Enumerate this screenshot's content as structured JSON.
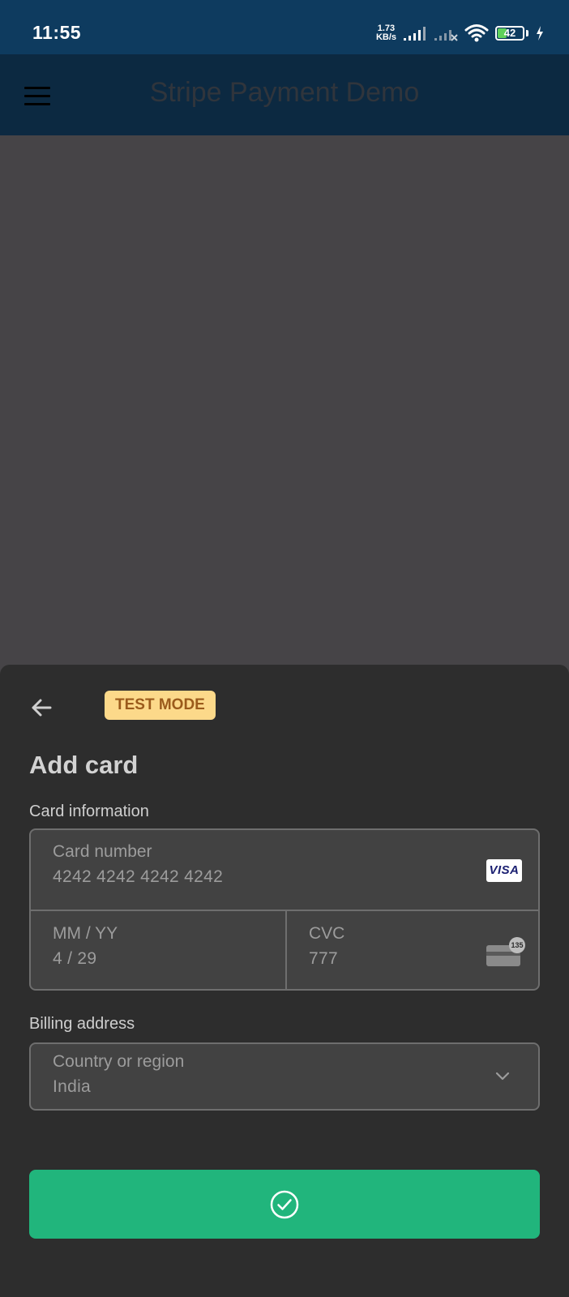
{
  "status_bar": {
    "time": "11:55",
    "net_speed_value": "1.73",
    "net_speed_unit": "KB/s",
    "battery_level": "42",
    "battery_color": "#5fd15b"
  },
  "app_bar": {
    "title": "Stripe Payment Demo",
    "menu_icon": "hamburger-menu-icon"
  },
  "sheet": {
    "back_icon": "arrow-left-icon",
    "badge": "TEST MODE",
    "title": "Add card",
    "card_section_label": "Card information",
    "card_number_label": "Card number",
    "card_number_value": "4242 4242 4242 4242",
    "card_brand": "VISA",
    "expiry_label": "MM / YY",
    "expiry_value": "4 / 29",
    "cvc_label": "CVC",
    "cvc_value": "777",
    "cvc_icon_text": "135",
    "billing_section_label": "Billing address",
    "country_label": "Country or region",
    "country_value": "India",
    "submit_icon": "check-circle-icon"
  },
  "colors": {
    "status_bar": "#0e3b5f",
    "app_bar": "#0c2941",
    "scrim": "#464447",
    "sheet": "#2d2d2d",
    "badge_bg": "#fcd98a",
    "badge_text": "#9b5b1c",
    "submit_button": "#21b57c"
  }
}
